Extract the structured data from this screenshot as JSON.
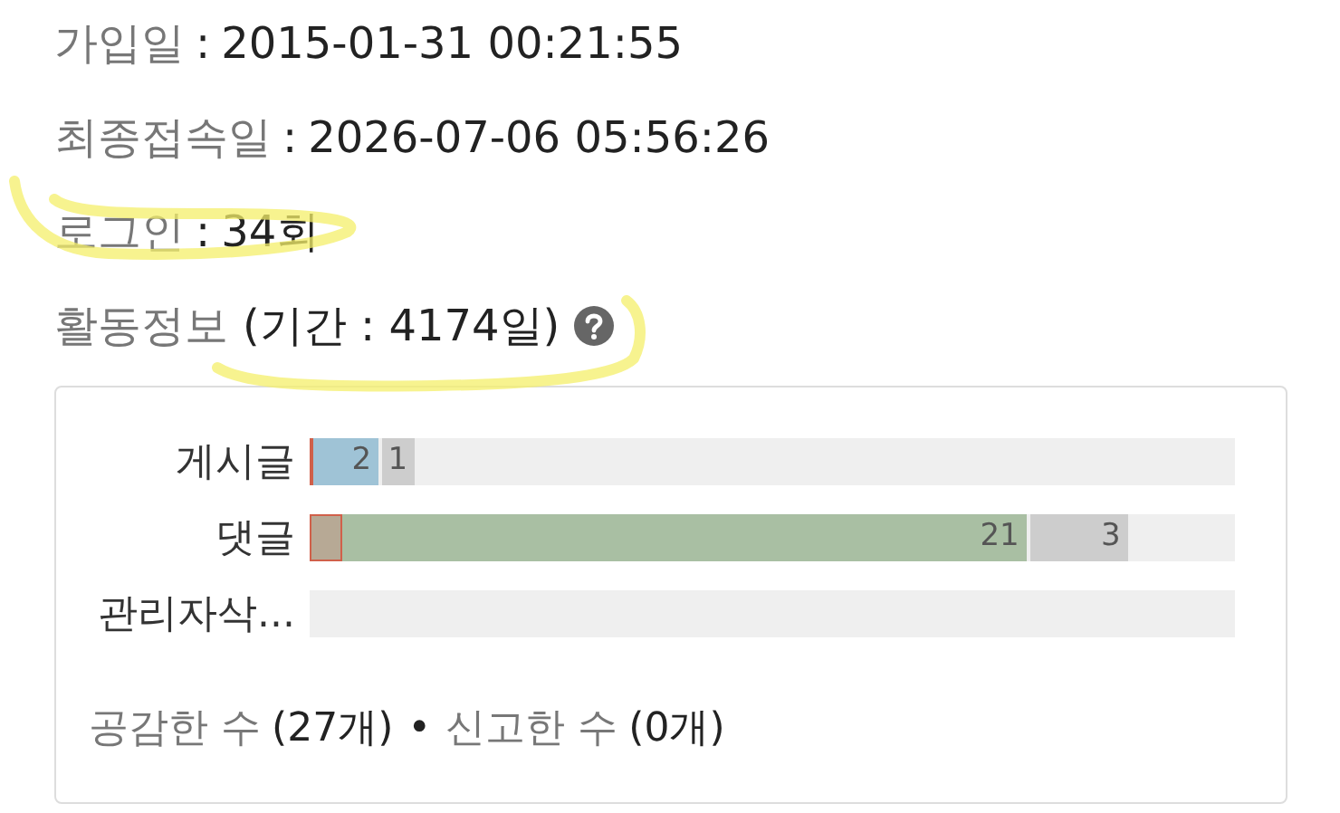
{
  "info_rows": [
    {
      "label": "가입일",
      "separator": ":",
      "value": "2015-01-31 00:21:55"
    },
    {
      "label": "최종접속일",
      "separator": ":",
      "value": "2026-07-06 05:56:26"
    },
    {
      "label": "로그인",
      "separator": ":",
      "value": "34회"
    }
  ],
  "activity": {
    "title": "활동정보",
    "period": "(기간 : 4174일)"
  },
  "bars": [
    {
      "label": "게시글",
      "segments": [
        {
          "color": "#d0604a",
          "level": 0.004
        },
        {
          "color": "#9fc3d6",
          "text": "2"
        },
        {
          "color": "#cdcdcd",
          "text": "1"
        }
      ]
    },
    {
      "label": "댓글",
      "segments": [
        {
          "color": "#b7a995",
          "level": 0.035
        },
        {
          "color": "#a9bfa3",
          "text": "21"
        },
        {
          "color": "#cdcdcd",
          "text": "3"
        }
      ]
    },
    {
      "label": "관리자삭..."
    }
  ],
  "stats": [
    {
      "label": "공감한 수",
      "value": "(27개)"
    },
    {
      "label": "신고한 수",
      "value": "(0개)"
    }
  ],
  "stats_separator": "•"
}
